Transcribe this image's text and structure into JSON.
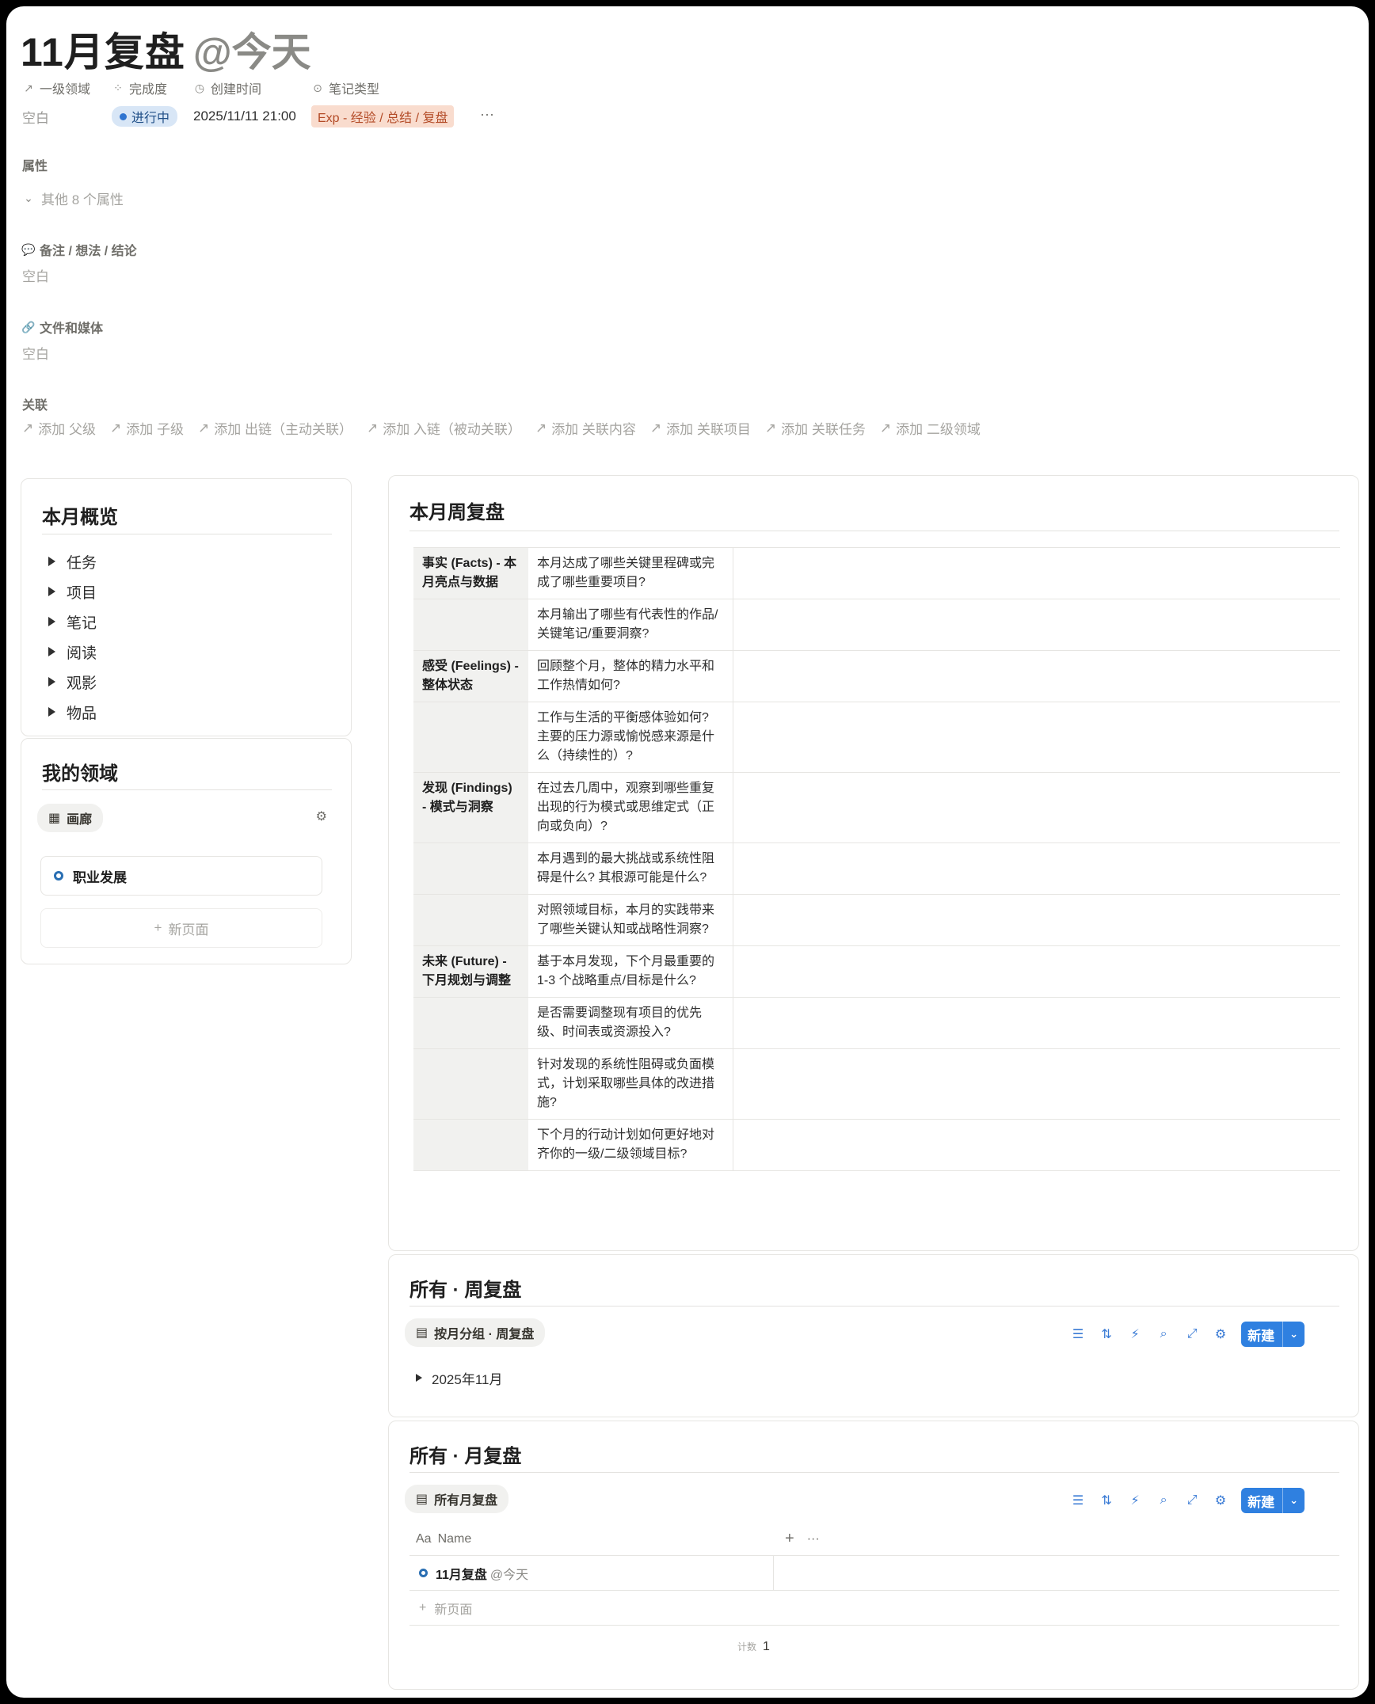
{
  "page": {
    "title": "11月复盘",
    "mention": "@今天"
  },
  "properties": [
    {
      "label": "一级领域",
      "icon": "arrow-up-right-icon",
      "value": "空白"
    },
    {
      "label": "完成度",
      "icon": "loading-spinner-icon",
      "value": "进行中"
    },
    {
      "label": "创建时间",
      "icon": "clock-icon",
      "value": "2025/11/11 21:00"
    },
    {
      "label": "笔记类型",
      "icon": "select-chevron-icon",
      "value": "Exp - 经验 / 总结 / 复盘"
    }
  ],
  "more_button": "···",
  "attributes": {
    "heading": "属性",
    "collapsed_label": "其他 8 个属性"
  },
  "notes": {
    "label": "备注 / 想法 / 结论",
    "value": "空白"
  },
  "files": {
    "label": "文件和媒体",
    "value": "空白"
  },
  "relations": {
    "label": "关联",
    "items": [
      "添加 父级",
      "添加 子级",
      "添加 出链（主动关联）",
      "添加 入链（被动关联）",
      "添加 关联内容",
      "添加 关联项目",
      "添加 关联任务",
      "添加 二级领域"
    ]
  },
  "overview": {
    "title": "本月概览",
    "items": [
      "任务",
      "项目",
      "笔记",
      "阅读",
      "观影",
      "物品"
    ]
  },
  "domains": {
    "title": "我的领域",
    "view_tab": "画廊",
    "cards": [
      "职业发展"
    ],
    "new_page": "新页面"
  },
  "weekly_review": {
    "title": "本月周复盘",
    "rows": [
      {
        "category": "事实 (Facts) - 本月亮点与数据",
        "question": "本月达成了哪些关键里程碑或完成了哪些重要项目?",
        "answer": ""
      },
      {
        "category": "",
        "question": "本月输出了哪些有代表性的作品/关键笔记/重要洞察?",
        "answer": ""
      },
      {
        "category": "感受 (Feelings) - 整体状态",
        "question": "回顾整个月，整体的精力水平和工作热情如何?",
        "answer": ""
      },
      {
        "category": "",
        "question": "工作与生活的平衡感体验如何? 主要的压力源或愉悦感来源是什么（持续性的）?",
        "answer": ""
      },
      {
        "category": "发现 (Findings) - 模式与洞察",
        "question": "在过去几周中，观察到哪些重复出现的行为模式或思维定式（正向或负向）?",
        "answer": ""
      },
      {
        "category": "",
        "question": "本月遇到的最大挑战或系统性阻碍是什么? 其根源可能是什么?",
        "answer": ""
      },
      {
        "category": "",
        "question": "对照领域目标，本月的实践带来了哪些关键认知或战略性洞察?",
        "answer": ""
      },
      {
        "category": "未来 (Future) - 下月规划与调整",
        "question": "基于本月发现，下个月最重要的 1-3 个战略重点/目标是什么?",
        "answer": ""
      },
      {
        "category": "",
        "question": "是否需要调整现有项目的优先级、时间表或资源投入?",
        "answer": ""
      },
      {
        "category": "",
        "question": "针对发现的系统性阻碍或负面模式，计划采取哪些具体的改进措施?",
        "answer": ""
      },
      {
        "category": "",
        "question": "下个月的行动计划如何更好地对齐你的一级/二级领域目标?",
        "answer": ""
      }
    ]
  },
  "all_weekly": {
    "title": "所有 · 周复盘",
    "view_tab": "按月分组 · 周复盘",
    "groups": [
      "2025年11月"
    ],
    "new_button": "新建"
  },
  "all_monthly": {
    "title": "所有 · 月复盘",
    "view_tab": "所有月复盘",
    "column_icon": "Aa",
    "column_name": "Name",
    "add_column": "+",
    "column_more": "···",
    "row_title": "11月复盘",
    "row_mention": "@今天",
    "new_page": "新页面",
    "count_label": "计数",
    "count_value": "1",
    "new_button": "新建"
  },
  "colors": {
    "accent_blue": "#2f80e0",
    "status_blue_bg": "#d8e6f6",
    "tag_orange_bg": "#f9dcce",
    "tag_orange_text": "#b34a26"
  }
}
